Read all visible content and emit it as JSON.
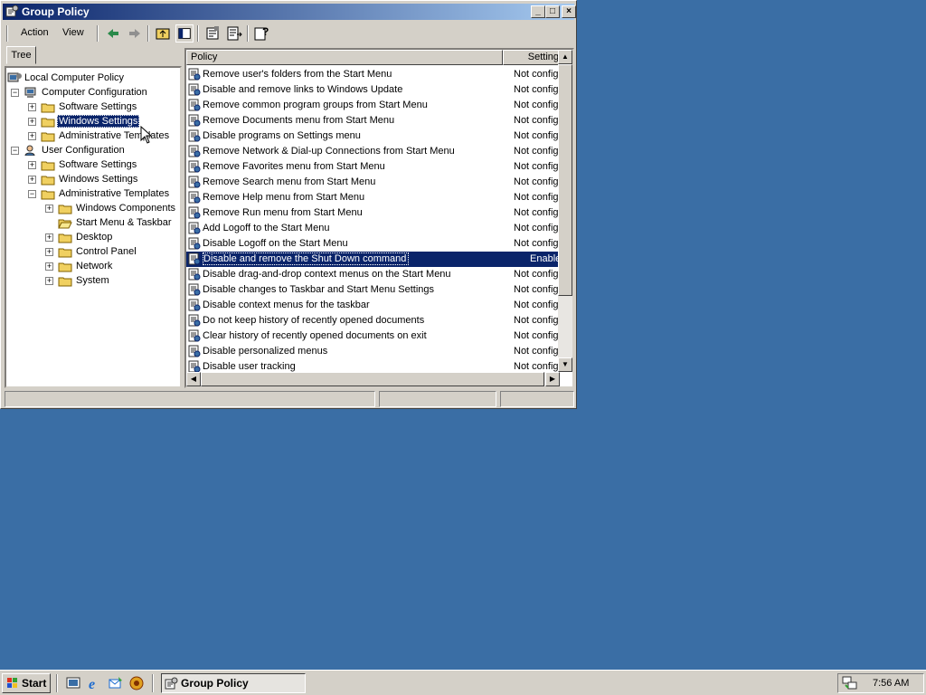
{
  "window": {
    "title": "Group Policy",
    "controls": {
      "minimize": "_",
      "maximize": "□",
      "close": "×"
    }
  },
  "menu": {
    "action": "Action",
    "view": "View"
  },
  "toolbar_icons": [
    "back-arrow-icon",
    "forward-arrow-icon",
    "up-folder-icon",
    "show-hide-tree-icon",
    "properties-icon",
    "export-list-icon",
    "help-icon"
  ],
  "tree_tab": "Tree",
  "tree": {
    "root": "Local Computer Policy",
    "computer_configuration": "Computer Configuration",
    "cc_software_settings": "Software Settings",
    "cc_windows_settings": "Windows Settings",
    "cc_administrative_templates": "Administrative Templates",
    "user_configuration": "User Configuration",
    "uc_software_settings": "Software Settings",
    "uc_windows_settings": "Windows Settings",
    "uc_administrative_templates": "Administrative Templates",
    "windows_components": "Windows Components",
    "start_menu_taskbar": "Start Menu & Taskbar",
    "desktop": "Desktop",
    "control_panel": "Control Panel",
    "network": "Network",
    "system": "System",
    "selected": "Windows Settings"
  },
  "list": {
    "columns": {
      "policy": "Policy",
      "setting": "Setting"
    },
    "rows": [
      {
        "policy": "Remove user's folders from the Start Menu",
        "setting": "Not configured"
      },
      {
        "policy": "Disable and remove links to Windows Update",
        "setting": "Not configured"
      },
      {
        "policy": "Remove common program groups from Start Menu",
        "setting": "Not configured"
      },
      {
        "policy": "Remove Documents menu from Start Menu",
        "setting": "Not configured"
      },
      {
        "policy": "Disable programs on Settings menu",
        "setting": "Not configured"
      },
      {
        "policy": "Remove Network & Dial-up Connections from Start Menu",
        "setting": "Not configured"
      },
      {
        "policy": "Remove Favorites menu from Start Menu",
        "setting": "Not configured"
      },
      {
        "policy": "Remove Search menu from Start Menu",
        "setting": "Not configured"
      },
      {
        "policy": "Remove Help menu from Start Menu",
        "setting": "Not configured"
      },
      {
        "policy": "Remove Run menu from Start Menu",
        "setting": "Not configured"
      },
      {
        "policy": "Add Logoff to the Start Menu",
        "setting": "Not configured"
      },
      {
        "policy": "Disable Logoff on the Start Menu",
        "setting": "Not configured"
      },
      {
        "policy": "Disable and remove the Shut Down command",
        "setting": "Enabled",
        "selected": true
      },
      {
        "policy": "Disable drag-and-drop context menus on the Start Menu",
        "setting": "Not configured"
      },
      {
        "policy": "Disable changes to Taskbar and Start Menu Settings",
        "setting": "Not configured"
      },
      {
        "policy": "Disable context menus for the taskbar",
        "setting": "Not configured"
      },
      {
        "policy": "Do not keep history of recently opened documents",
        "setting": "Not configured"
      },
      {
        "policy": "Clear history of recently opened documents on exit",
        "setting": "Not configured"
      },
      {
        "policy": "Disable personalized menus",
        "setting": "Not configured"
      },
      {
        "policy": "Disable user tracking",
        "setting": "Not configured"
      }
    ]
  },
  "taskbar": {
    "start_label": "Start",
    "quick_launch": [
      "show-desktop-icon",
      "internet-explorer-icon",
      "outlook-express-icon",
      "media-player-icon"
    ],
    "task_label": "Group Policy",
    "clock": "7:56 AM"
  },
  "colors": {
    "desktop": "#3a6ea5",
    "title_active": "#0a246a",
    "selection": "#0a246a",
    "face": "#d4d0c8"
  }
}
